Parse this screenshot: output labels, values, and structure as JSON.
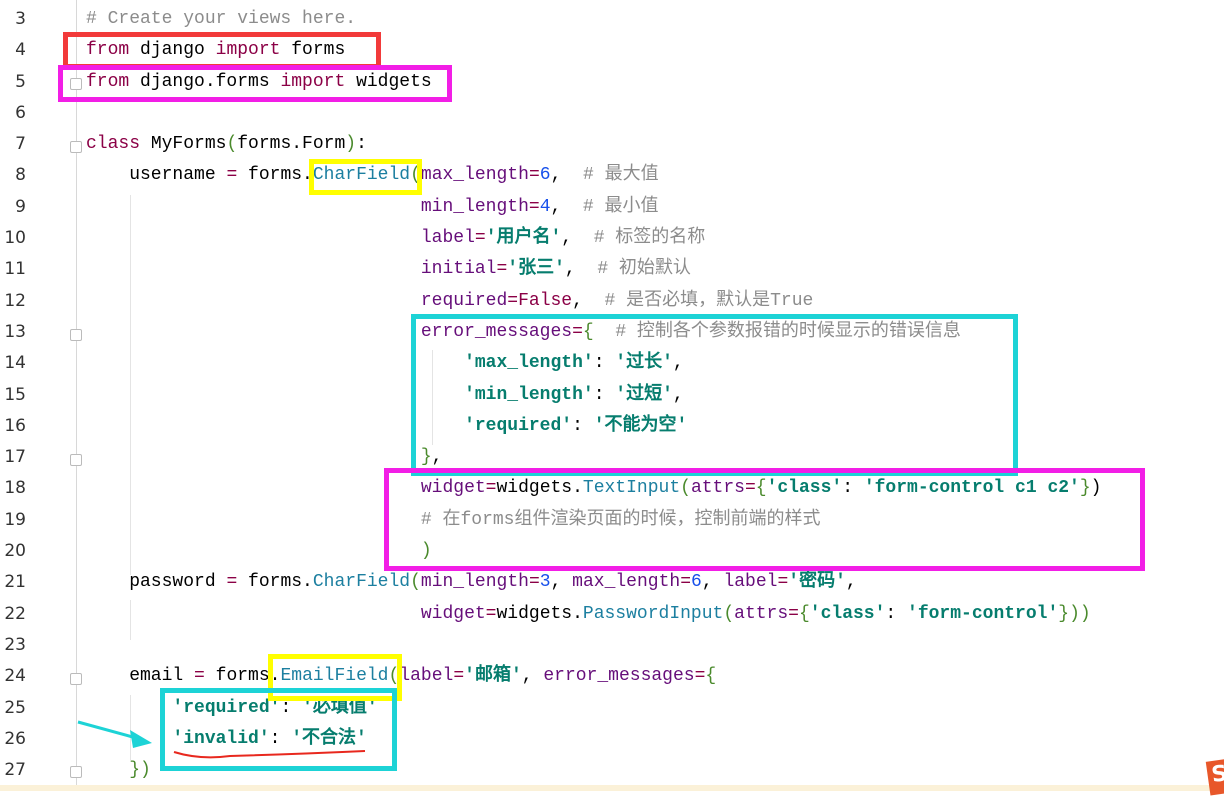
{
  "editor": {
    "lines": [
      {
        "number": "3",
        "tokens": [
          [
            "# Create your views here.",
            "c"
          ]
        ]
      },
      {
        "number": "4",
        "tokens": [
          [
            "from",
            "k"
          ],
          [
            " django ",
            "t"
          ],
          [
            "import",
            "k"
          ],
          [
            " forms",
            "t"
          ]
        ]
      },
      {
        "number": "5",
        "tokens": [
          [
            "from",
            "k"
          ],
          [
            " django.forms ",
            "t"
          ],
          [
            "import",
            "k"
          ],
          [
            " widgets",
            "t"
          ]
        ]
      },
      {
        "number": "6",
        "tokens": []
      },
      {
        "number": "7",
        "tokens": [
          [
            "class",
            "k"
          ],
          [
            " MyForms",
            "t"
          ],
          [
            "(",
            "b"
          ],
          [
            "forms.Form",
            "t"
          ],
          [
            ")",
            "b"
          ],
          [
            ":",
            "t"
          ]
        ]
      },
      {
        "number": "8",
        "tokens": [
          [
            "    username ",
            "t"
          ],
          [
            "=",
            "k"
          ],
          [
            " forms.",
            "t"
          ],
          [
            "CharField",
            "f"
          ],
          [
            "(",
            "b"
          ],
          [
            "max_length",
            "p"
          ],
          [
            "=",
            "k"
          ],
          [
            "6",
            "n"
          ],
          [
            ",  ",
            "t"
          ],
          [
            "# 最大值",
            "c"
          ]
        ]
      },
      {
        "number": "9",
        "tokens": [
          [
            "                               ",
            "t"
          ],
          [
            "min_length",
            "p"
          ],
          [
            "=",
            "k"
          ],
          [
            "4",
            "n"
          ],
          [
            ",  ",
            "t"
          ],
          [
            "# 最小值",
            "c"
          ]
        ]
      },
      {
        "number": "10",
        "tokens": [
          [
            "                               ",
            "t"
          ],
          [
            "label",
            "p"
          ],
          [
            "=",
            "k"
          ],
          [
            "'用户名'",
            "s"
          ],
          [
            ",  ",
            "t"
          ],
          [
            "# 标签的名称",
            "c"
          ]
        ]
      },
      {
        "number": "11",
        "tokens": [
          [
            "                               ",
            "t"
          ],
          [
            "initial",
            "p"
          ],
          [
            "=",
            "k"
          ],
          [
            "'张三'",
            "s"
          ],
          [
            ",  ",
            "t"
          ],
          [
            "# 初始默认",
            "c"
          ]
        ]
      },
      {
        "number": "12",
        "tokens": [
          [
            "                               ",
            "t"
          ],
          [
            "required",
            "p"
          ],
          [
            "=",
            "k"
          ],
          [
            "False",
            "k"
          ],
          [
            ",  ",
            "t"
          ],
          [
            "# 是否必填，默认是True",
            "c"
          ]
        ]
      },
      {
        "number": "13",
        "tokens": [
          [
            "                               ",
            "t"
          ],
          [
            "error_messages",
            "p"
          ],
          [
            "=",
            "k"
          ],
          [
            "{",
            "b"
          ],
          [
            "  ",
            "t"
          ],
          [
            "# 控制各个参数报错的时候显示的错误信息",
            "c"
          ]
        ]
      },
      {
        "number": "14",
        "tokens": [
          [
            "                                   ",
            "t"
          ],
          [
            "'max_length'",
            "s"
          ],
          [
            ": ",
            "t"
          ],
          [
            "'过长'",
            "s"
          ],
          [
            ",",
            "t"
          ]
        ]
      },
      {
        "number": "15",
        "tokens": [
          [
            "                                   ",
            "t"
          ],
          [
            "'min_length'",
            "s"
          ],
          [
            ": ",
            "t"
          ],
          [
            "'过短'",
            "s"
          ],
          [
            ",",
            "t"
          ]
        ]
      },
      {
        "number": "16",
        "tokens": [
          [
            "                                   ",
            "t"
          ],
          [
            "'required'",
            "s"
          ],
          [
            ": ",
            "t"
          ],
          [
            "'不能为空'",
            "s"
          ]
        ]
      },
      {
        "number": "17",
        "tokens": [
          [
            "                               ",
            "t"
          ],
          [
            "}",
            "b"
          ],
          [
            ",",
            "t"
          ]
        ]
      },
      {
        "number": "18",
        "tokens": [
          [
            "                               ",
            "t"
          ],
          [
            "widget",
            "p"
          ],
          [
            "=",
            "k"
          ],
          [
            "widgets.",
            "t"
          ],
          [
            "TextInput",
            "f"
          ],
          [
            "(",
            "b"
          ],
          [
            "attrs",
            "p"
          ],
          [
            "=",
            "k"
          ],
          [
            "{",
            "b"
          ],
          [
            "'class'",
            "s"
          ],
          [
            ": ",
            "t"
          ],
          [
            "'form-control c1 c2'",
            "s"
          ],
          [
            "}",
            "b"
          ],
          [
            ")",
            "t"
          ]
        ]
      },
      {
        "number": "19",
        "tokens": [
          [
            "                               ",
            "t"
          ],
          [
            "# 在forms组件渲染页面的时候，控制前端的样式",
            "c"
          ]
        ]
      },
      {
        "number": "20",
        "tokens": [
          [
            "                               ",
            "t"
          ],
          [
            ")",
            "b"
          ]
        ]
      },
      {
        "number": "21",
        "tokens": [
          [
            "    password ",
            "t"
          ],
          [
            "=",
            "k"
          ],
          [
            " forms.",
            "t"
          ],
          [
            "CharField",
            "f"
          ],
          [
            "(",
            "b"
          ],
          [
            "min_length",
            "p"
          ],
          [
            "=",
            "k"
          ],
          [
            "3",
            "n"
          ],
          [
            ", ",
            "t"
          ],
          [
            "max_length",
            "p"
          ],
          [
            "=",
            "k"
          ],
          [
            "6",
            "n"
          ],
          [
            ", ",
            "t"
          ],
          [
            "label",
            "p"
          ],
          [
            "=",
            "k"
          ],
          [
            "'密码'",
            "s"
          ],
          [
            ",",
            "t"
          ]
        ]
      },
      {
        "number": "22",
        "tokens": [
          [
            "                               ",
            "t"
          ],
          [
            "widget",
            "p"
          ],
          [
            "=",
            "k"
          ],
          [
            "widgets.",
            "t"
          ],
          [
            "PasswordInput",
            "f"
          ],
          [
            "(",
            "b"
          ],
          [
            "attrs",
            "p"
          ],
          [
            "=",
            "k"
          ],
          [
            "{",
            "b"
          ],
          [
            "'class'",
            "s"
          ],
          [
            ": ",
            "t"
          ],
          [
            "'form-control'",
            "s"
          ],
          [
            "}",
            "b"
          ],
          [
            "))",
            "b"
          ]
        ]
      },
      {
        "number": "23",
        "tokens": []
      },
      {
        "number": "24",
        "tokens": [
          [
            "    email ",
            "t"
          ],
          [
            "=",
            "k"
          ],
          [
            " forms.",
            "t"
          ],
          [
            "EmailField",
            "f"
          ],
          [
            "(",
            "b"
          ],
          [
            "label",
            "p"
          ],
          [
            "=",
            "k"
          ],
          [
            "'邮箱'",
            "s"
          ],
          [
            ", ",
            "t"
          ],
          [
            "error_messages",
            "p"
          ],
          [
            "=",
            "k"
          ],
          [
            "{",
            "b"
          ]
        ]
      },
      {
        "number": "25",
        "tokens": [
          [
            "        ",
            "t"
          ],
          [
            "'required'",
            "s"
          ],
          [
            ": ",
            "t"
          ],
          [
            "'必填值'",
            "s"
          ]
        ]
      },
      {
        "number": "26",
        "tokens": [
          [
            "        ",
            "t"
          ],
          [
            "'invalid'",
            "s"
          ],
          [
            ": ",
            "t"
          ],
          [
            "'不合法'",
            "s"
          ]
        ]
      },
      {
        "number": "27",
        "tokens": [
          [
            "    ",
            "t"
          ],
          [
            "})",
            "b"
          ]
        ]
      }
    ]
  },
  "annotations": {
    "red": "#f23a3a",
    "magenta": "#f21ee6",
    "yellow": "#ffff00",
    "cyan": "#1dd3d6",
    "underline": "#e8281e"
  },
  "logo": {
    "glyph": "S"
  }
}
